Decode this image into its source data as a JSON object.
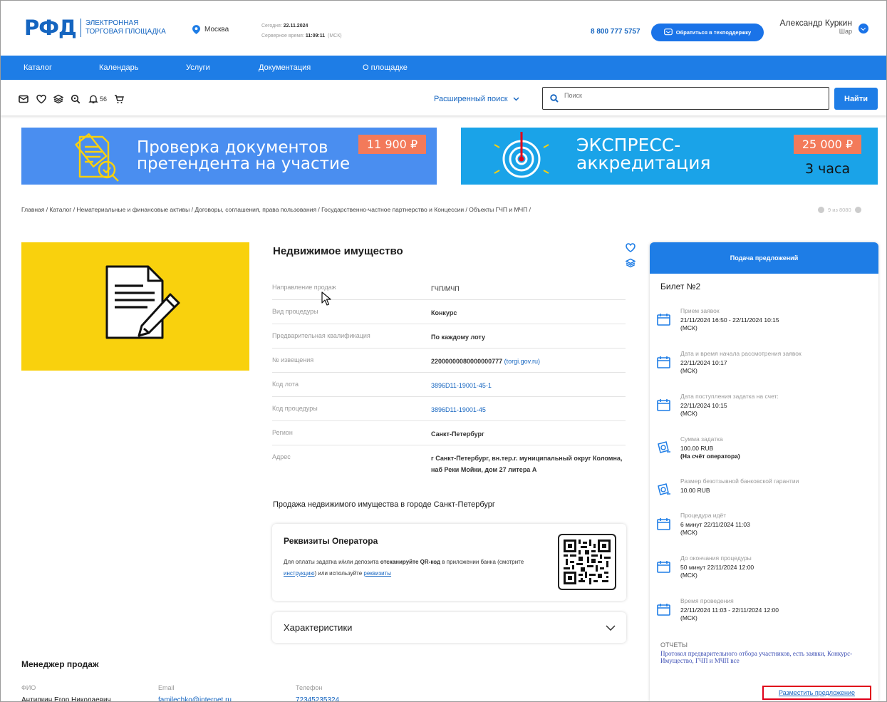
{
  "header": {
    "logo_mark": "РФД",
    "logo_line1": "ЭЛЕКТРОННАЯ",
    "logo_line2": "ТОРГОВАЯ ПЛОЩАДКА",
    "city": "Москва",
    "today_label": "Сегодня:",
    "today_value": "22.11.2024",
    "server_time_label": "Серверное время:",
    "server_time_value": "11:09:11",
    "server_time_tz": "(МСК)",
    "phone": "8 800 777 5757",
    "support_button": "Обратиться в техподдержку",
    "user_name": "Александр Куркин",
    "user_sub": "Шар"
  },
  "nav": {
    "items": [
      "Каталог",
      "Календарь",
      "Услуги",
      "Документация",
      "О площадке"
    ]
  },
  "toolbar": {
    "notifications_count": "56",
    "advanced_search": "Расширенный поиск",
    "search_placeholder": "Поиск",
    "find_button": "Найти"
  },
  "banners": [
    {
      "line1": "Проверка документов",
      "line2": "претендента на участие",
      "price": "11 900 ₽"
    },
    {
      "line1": "ЭКСПРЕСС-",
      "line2": "аккредитация",
      "price": "25 000 ₽",
      "duration": "3 часа"
    }
  ],
  "breadcrumb": "Главная  /  Каталог  /  Нематериальные и финансовые активы  /  Договоры, соглашения, права пользования  /  Государственно-частное партнерство и Концессии  /  Объекты ГЧП и МЧП  /",
  "pager": "9 из 8080",
  "lot": {
    "title": "Недвижимое имущество",
    "fields": [
      {
        "label": "Направление продаж",
        "value": "ГЧП/МЧП"
      },
      {
        "label": "Вид процедуры",
        "value": "Конкурс"
      },
      {
        "label": "Предварительная квалификация",
        "value": "По каждому лоту"
      },
      {
        "label": "№ извещения",
        "value": "22000000080000000777",
        "extra": "(torgi.gov.ru)"
      },
      {
        "label": "Код лота",
        "value": "3896D11-19001-45-1"
      },
      {
        "label": "Код процедуры",
        "value": "3896D11-19001-45"
      },
      {
        "label": "Регион",
        "value": "Санкт-Петербург"
      },
      {
        "label": "Адрес",
        "value": "г Санкт-Петербург, вн.тер.г. муниципальный округ Коломна, наб Реки Мойки, дом 27 литера А"
      }
    ],
    "sale_description": "Продажа недвижимого имущества в городе Санкт-Петербург"
  },
  "operator_card": {
    "title": "Реквизиты Оператора",
    "text1": "Для оплаты задатка и/или депозита ",
    "text_bold": "отсканируйте QR-код",
    "text2": " в приложении банка (смотрите ",
    "link_instruction": "инструкцию",
    "text3": ") или используйте ",
    "link_requisites": "реквизиты"
  },
  "characteristics": {
    "title": "Характеристики"
  },
  "manager": {
    "title": "Менеджер продаж",
    "fio_label": "ФИО",
    "fio": "Антипкин Егор Николаевич",
    "email_label": "Email",
    "email": "familechko@internet.ru",
    "phone_label": "Телефон",
    "phone": "72345235324"
  },
  "sidebar": {
    "header": "Подача предложений",
    "ticket": "Билет №2",
    "items": [
      {
        "icon": "calendar-icon",
        "label": "Прием заявок",
        "value": "21/11/2024 16:50  - 22/11/2024 10:15",
        "value2": "(МСК)"
      },
      {
        "icon": "calendar-icon",
        "label": "Дата и время начала рассмотрения заявок",
        "value": "22/11/2024 10:17",
        "value2": "(МСК)"
      },
      {
        "icon": "calendar-icon",
        "label": "Дата поступления задатка на счет:",
        "value": "22/11/2024 10:15",
        "value2": "(МСК)"
      },
      {
        "icon": "money-icon",
        "label": "Сумма задатка",
        "value": "100.00 RUB",
        "value2": "(На счёт оператора)"
      },
      {
        "icon": "money-icon",
        "label": "Размер безотзывной банковской гарантии",
        "value": "10.00 RUB",
        "value2": ""
      },
      {
        "icon": "calendar-icon",
        "label": "Процедура идёт",
        "value": "6 минут 22/11/2024 11:03",
        "value2": "(МСК)"
      },
      {
        "icon": "calendar-icon",
        "label": "До окончания процедуры",
        "value": "50 минут 22/11/2024 12:00",
        "value2": "(МСК)"
      },
      {
        "icon": "calendar-icon",
        "label": "Время проведения",
        "value": "22/11/2024 11:03 - 22/11/2024 12:00",
        "value2": "(МСК)"
      }
    ],
    "reports_label": "ОТЧЕТЫ",
    "reports_link": "Протокол предварительного отбора участников, есть заявки, Конкурс-Имущество, ГЧП и МЧП все",
    "place_offer": "Разместить предложение"
  },
  "colors": {
    "brand_blue": "#1e7de6",
    "link_blue": "#1565c0",
    "banner1": "#4a8ef0",
    "banner2": "#1aa3e8",
    "price_tag": "#f37a5a",
    "image_bg": "#f9d10d",
    "highlight_red": "#e0001a"
  }
}
